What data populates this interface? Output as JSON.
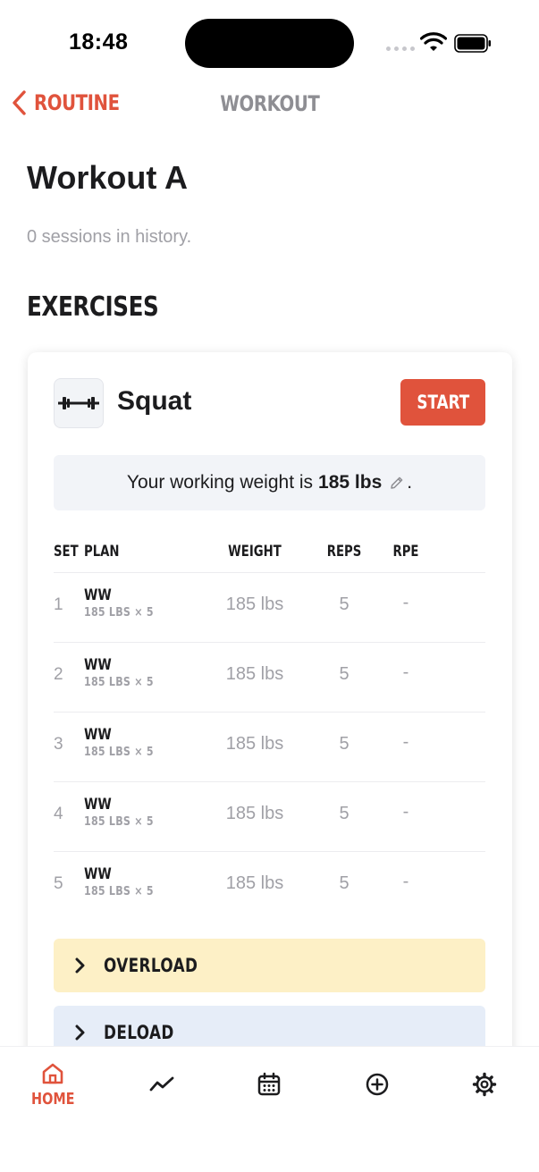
{
  "status_bar": {
    "time": "18:48"
  },
  "nav": {
    "back_label": "ROUTINE",
    "title": "WORKOUT"
  },
  "page": {
    "title": "Workout A",
    "history_text": "0 sessions in history."
  },
  "section": {
    "exercises_title": "EXERCISES"
  },
  "exercise": {
    "name": "Squat",
    "start_label": "START",
    "working_weight_prefix": "Your working weight is",
    "working_weight_value": "185 lbs",
    "working_weight_suffix": "."
  },
  "table": {
    "headers": {
      "set": "SET",
      "plan": "PLAN",
      "weight": "WEIGHT",
      "reps": "REPS",
      "rpe": "RPE"
    },
    "rows": [
      {
        "set": "1",
        "plan": "WW",
        "plan_detail": "185 LBS × 5",
        "weight": "185 lbs",
        "reps": "5",
        "rpe": "-"
      },
      {
        "set": "2",
        "plan": "WW",
        "plan_detail": "185 LBS × 5",
        "weight": "185 lbs",
        "reps": "5",
        "rpe": "-"
      },
      {
        "set": "3",
        "plan": "WW",
        "plan_detail": "185 LBS × 5",
        "weight": "185 lbs",
        "reps": "5",
        "rpe": "-"
      },
      {
        "set": "4",
        "plan": "WW",
        "plan_detail": "185 LBS × 5",
        "weight": "185 lbs",
        "reps": "5",
        "rpe": "-"
      },
      {
        "set": "5",
        "plan": "WW",
        "plan_detail": "185 LBS × 5",
        "weight": "185 lbs",
        "reps": "5",
        "rpe": "-"
      }
    ]
  },
  "accordions": {
    "overload": "OVERLOAD",
    "deload": "DELOAD"
  },
  "tabbar": {
    "home_label": "HOME",
    "icons": [
      "home-icon",
      "chart-line-icon",
      "calendar-icon",
      "plus-circle-icon",
      "gear-icon"
    ]
  },
  "colors": {
    "accent": "#e0533c",
    "overload_bg": "#fdf0c6",
    "deload_bg": "#e6edf8",
    "banner_bg": "#f2f4f8"
  }
}
